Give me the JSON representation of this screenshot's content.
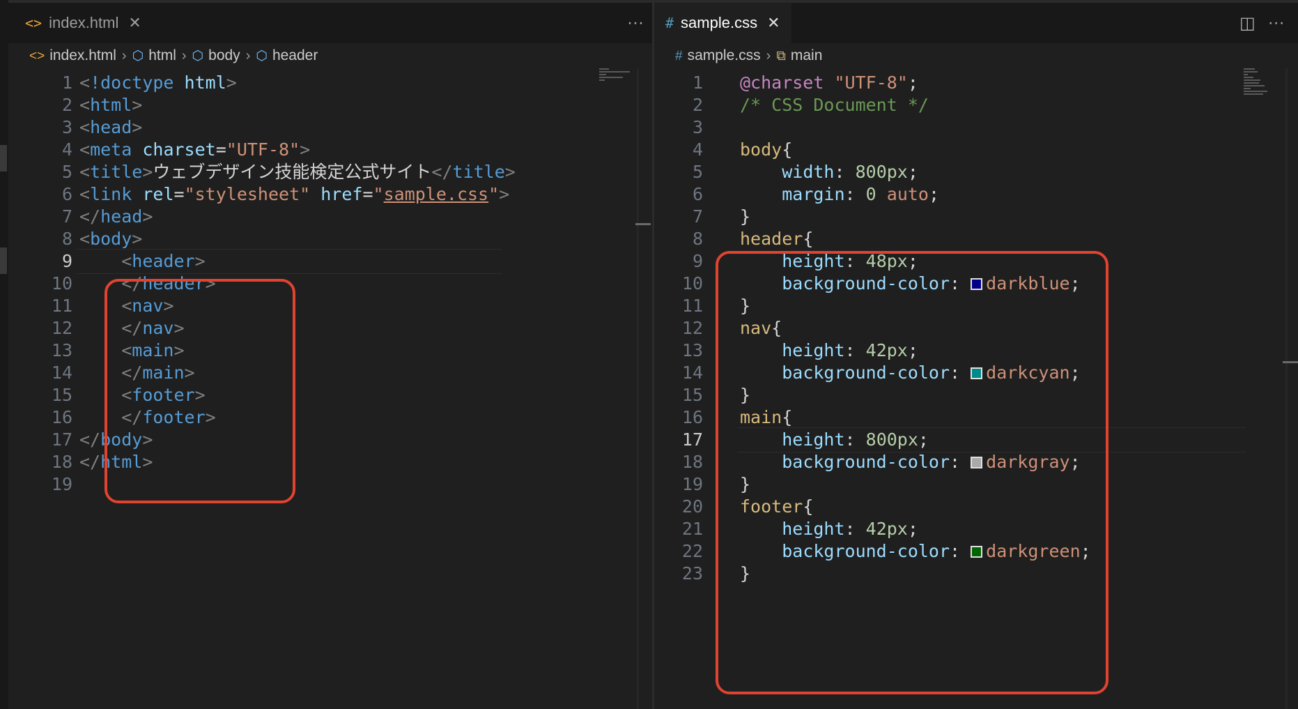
{
  "left_editor": {
    "tab": {
      "icon": "<>",
      "label": "index.html",
      "close": "✕"
    },
    "tab_more": "···",
    "breadcrumb": [
      {
        "icon": "<>",
        "label": "index.html"
      },
      {
        "icon": "⬡",
        "label": "html"
      },
      {
        "icon": "⬡",
        "label": "body"
      },
      {
        "icon": "⬡",
        "label": "header"
      }
    ],
    "current_line": 9,
    "lines": [
      {
        "n": "1",
        "tokens": [
          [
            "t-punc",
            "<"
          ],
          [
            "t-tag",
            "!doctype"
          ],
          [
            "t-text",
            " "
          ],
          [
            "t-attr",
            "html"
          ],
          [
            "t-punc",
            ">"
          ]
        ]
      },
      {
        "n": "2",
        "tokens": [
          [
            "t-punc",
            "<"
          ],
          [
            "t-tag",
            "html"
          ],
          [
            "t-punc",
            ">"
          ]
        ]
      },
      {
        "n": "3",
        "tokens": [
          [
            "t-punc",
            "<"
          ],
          [
            "t-tag",
            "head"
          ],
          [
            "t-punc",
            ">"
          ]
        ]
      },
      {
        "n": "4",
        "tokens": [
          [
            "t-punc",
            "<"
          ],
          [
            "t-tag",
            "meta"
          ],
          [
            "t-text",
            " "
          ],
          [
            "t-attr",
            "charset"
          ],
          [
            "t-text",
            "="
          ],
          [
            "t-str",
            "\"UTF-8\""
          ],
          [
            "t-punc",
            ">"
          ]
        ]
      },
      {
        "n": "5",
        "tokens": [
          [
            "t-punc",
            "<"
          ],
          [
            "t-tag",
            "title"
          ],
          [
            "t-punc",
            ">"
          ],
          [
            "t-text",
            "ウェブデザイン技能検定公式サイト"
          ],
          [
            "t-punc",
            "</"
          ],
          [
            "t-tag",
            "title"
          ],
          [
            "t-punc",
            ">"
          ]
        ]
      },
      {
        "n": "6",
        "tokens": [
          [
            "t-punc",
            "<"
          ],
          [
            "t-tag",
            "link"
          ],
          [
            "t-text",
            " "
          ],
          [
            "t-attr",
            "rel"
          ],
          [
            "t-text",
            "="
          ],
          [
            "t-str",
            "\"stylesheet\""
          ],
          [
            "t-text",
            " "
          ],
          [
            "t-attr",
            "href"
          ],
          [
            "t-text",
            "="
          ],
          [
            "t-str",
            "\""
          ],
          [
            "t-str t-link",
            "sample.css"
          ],
          [
            "t-str",
            "\""
          ],
          [
            "t-punc",
            ">"
          ]
        ]
      },
      {
        "n": "7",
        "tokens": [
          [
            "t-punc",
            "</"
          ],
          [
            "t-tag",
            "head"
          ],
          [
            "t-punc",
            ">"
          ]
        ]
      },
      {
        "n": "8",
        "tokens": [
          [
            "t-punc",
            "<"
          ],
          [
            "t-tag",
            "body"
          ],
          [
            "t-punc",
            ">"
          ]
        ]
      },
      {
        "n": "9",
        "tokens": [
          [
            "t-text",
            "    "
          ],
          [
            "t-punc",
            "<"
          ],
          [
            "t-tag",
            "header"
          ],
          [
            "t-punc",
            ">"
          ]
        ]
      },
      {
        "n": "10",
        "tokens": [
          [
            "t-text",
            "    "
          ],
          [
            "t-punc",
            "</"
          ],
          [
            "t-tag",
            "header"
          ],
          [
            "t-punc",
            ">"
          ]
        ]
      },
      {
        "n": "11",
        "tokens": [
          [
            "t-text",
            "    "
          ],
          [
            "t-punc",
            "<"
          ],
          [
            "t-tag",
            "nav"
          ],
          [
            "t-punc",
            ">"
          ]
        ]
      },
      {
        "n": "12",
        "tokens": [
          [
            "t-text",
            "    "
          ],
          [
            "t-punc",
            "</"
          ],
          [
            "t-tag",
            "nav"
          ],
          [
            "t-punc",
            ">"
          ]
        ]
      },
      {
        "n": "13",
        "tokens": [
          [
            "t-text",
            "    "
          ],
          [
            "t-punc",
            "<"
          ],
          [
            "t-tag",
            "main"
          ],
          [
            "t-punc",
            ">"
          ]
        ]
      },
      {
        "n": "14",
        "tokens": [
          [
            "t-text",
            "    "
          ],
          [
            "t-punc",
            "</"
          ],
          [
            "t-tag",
            "main"
          ],
          [
            "t-punc",
            ">"
          ]
        ]
      },
      {
        "n": "15",
        "tokens": [
          [
            "t-text",
            "    "
          ],
          [
            "t-punc",
            "<"
          ],
          [
            "t-tag",
            "footer"
          ],
          [
            "t-punc",
            ">"
          ]
        ]
      },
      {
        "n": "16",
        "tokens": [
          [
            "t-text",
            "    "
          ],
          [
            "t-punc",
            "</"
          ],
          [
            "t-tag",
            "footer"
          ],
          [
            "t-punc",
            ">"
          ]
        ]
      },
      {
        "n": "17",
        "tokens": [
          [
            "t-punc",
            "</"
          ],
          [
            "t-tag",
            "body"
          ],
          [
            "t-punc",
            ">"
          ]
        ]
      },
      {
        "n": "18",
        "tokens": [
          [
            "t-punc",
            "</"
          ],
          [
            "t-tag",
            "html"
          ],
          [
            "t-punc",
            ">"
          ]
        ]
      },
      {
        "n": "19",
        "tokens": []
      }
    ]
  },
  "right_editor": {
    "tab": {
      "icon": "#",
      "label": "sample.css",
      "close": "✕"
    },
    "tab_actions": {
      "split": "◫",
      "more": "···"
    },
    "breadcrumb": [
      {
        "icon": "#",
        "label": "sample.css"
      },
      {
        "icon": "⧉",
        "label": "main"
      }
    ],
    "current_line": 17,
    "lines": [
      {
        "n": "1",
        "tokens": [
          [
            "t-kw",
            "@charset"
          ],
          [
            "t-text",
            " "
          ],
          [
            "t-str",
            "\"UTF-8\""
          ],
          [
            "t-brace",
            ";"
          ]
        ]
      },
      {
        "n": "2",
        "tokens": [
          [
            "t-com",
            "/* CSS Document */"
          ]
        ]
      },
      {
        "n": "3",
        "tokens": []
      },
      {
        "n": "4",
        "tokens": [
          [
            "t-sel",
            "body"
          ],
          [
            "t-brace",
            "{"
          ]
        ]
      },
      {
        "n": "5",
        "tokens": [
          [
            "t-text",
            "    "
          ],
          [
            "t-prop",
            "width"
          ],
          [
            "t-brace",
            ": "
          ],
          [
            "t-num",
            "800px"
          ],
          [
            "t-brace",
            ";"
          ]
        ]
      },
      {
        "n": "6",
        "tokens": [
          [
            "t-text",
            "    "
          ],
          [
            "t-prop",
            "margin"
          ],
          [
            "t-brace",
            ": "
          ],
          [
            "t-num",
            "0"
          ],
          [
            "t-text",
            " "
          ],
          [
            "t-val",
            "auto"
          ],
          [
            "t-brace",
            ";"
          ]
        ]
      },
      {
        "n": "7",
        "tokens": [
          [
            "t-brace",
            "}"
          ]
        ]
      },
      {
        "n": "8",
        "tokens": [
          [
            "t-sel",
            "header"
          ],
          [
            "t-brace",
            "{"
          ]
        ]
      },
      {
        "n": "9",
        "tokens": [
          [
            "t-text",
            "    "
          ],
          [
            "t-prop",
            "height"
          ],
          [
            "t-brace",
            ": "
          ],
          [
            "t-num",
            "48px"
          ],
          [
            "t-brace",
            ";"
          ]
        ]
      },
      {
        "n": "10",
        "tokens": [
          [
            "t-text",
            "    "
          ],
          [
            "t-prop",
            "background-color"
          ],
          [
            "t-brace",
            ": "
          ],
          [
            "swatch",
            "#00008b"
          ],
          [
            "t-val",
            "darkblue"
          ],
          [
            "t-brace",
            ";"
          ]
        ]
      },
      {
        "n": "11",
        "tokens": [
          [
            "t-brace",
            "}"
          ]
        ]
      },
      {
        "n": "12",
        "tokens": [
          [
            "t-sel",
            "nav"
          ],
          [
            "t-brace",
            "{"
          ]
        ]
      },
      {
        "n": "13",
        "tokens": [
          [
            "t-text",
            "    "
          ],
          [
            "t-prop",
            "height"
          ],
          [
            "t-brace",
            ": "
          ],
          [
            "t-num",
            "42px"
          ],
          [
            "t-brace",
            ";"
          ]
        ]
      },
      {
        "n": "14",
        "tokens": [
          [
            "t-text",
            "    "
          ],
          [
            "t-prop",
            "background-color"
          ],
          [
            "t-brace",
            ": "
          ],
          [
            "swatch",
            "#008b8b"
          ],
          [
            "t-val",
            "darkcyan"
          ],
          [
            "t-brace",
            ";"
          ]
        ]
      },
      {
        "n": "15",
        "tokens": [
          [
            "t-brace",
            "}"
          ]
        ]
      },
      {
        "n": "16",
        "tokens": [
          [
            "t-sel",
            "main"
          ],
          [
            "t-brace",
            "{"
          ]
        ]
      },
      {
        "n": "17",
        "tokens": [
          [
            "t-text",
            "    "
          ],
          [
            "t-prop",
            "height"
          ],
          [
            "t-brace",
            ": "
          ],
          [
            "t-num",
            "800px"
          ],
          [
            "t-brace",
            ";"
          ]
        ]
      },
      {
        "n": "18",
        "tokens": [
          [
            "t-text",
            "    "
          ],
          [
            "t-prop",
            "background-color"
          ],
          [
            "t-brace",
            ": "
          ],
          [
            "swatch",
            "#a9a9a9"
          ],
          [
            "t-val",
            "darkgray"
          ],
          [
            "t-brace",
            ";"
          ]
        ]
      },
      {
        "n": "19",
        "tokens": [
          [
            "t-brace",
            "}"
          ]
        ]
      },
      {
        "n": "20",
        "tokens": [
          [
            "t-sel",
            "footer"
          ],
          [
            "t-brace",
            "{"
          ]
        ]
      },
      {
        "n": "21",
        "tokens": [
          [
            "t-text",
            "    "
          ],
          [
            "t-prop",
            "height"
          ],
          [
            "t-brace",
            ": "
          ],
          [
            "t-num",
            "42px"
          ],
          [
            "t-brace",
            ";"
          ]
        ]
      },
      {
        "n": "22",
        "tokens": [
          [
            "t-text",
            "    "
          ],
          [
            "t-prop",
            "background-color"
          ],
          [
            "t-brace",
            ": "
          ],
          [
            "swatch",
            "#006400"
          ],
          [
            "t-val",
            "darkgreen"
          ],
          [
            "t-brace",
            ";"
          ]
        ]
      },
      {
        "n": "23",
        "tokens": [
          [
            "t-brace",
            "}"
          ]
        ]
      }
    ]
  },
  "colors": {
    "highlight_border": "#e0432f",
    "editor_bg": "#1f1f1f",
    "tab_icon_html": "#e8a23a",
    "tab_icon_css": "#519aba"
  }
}
